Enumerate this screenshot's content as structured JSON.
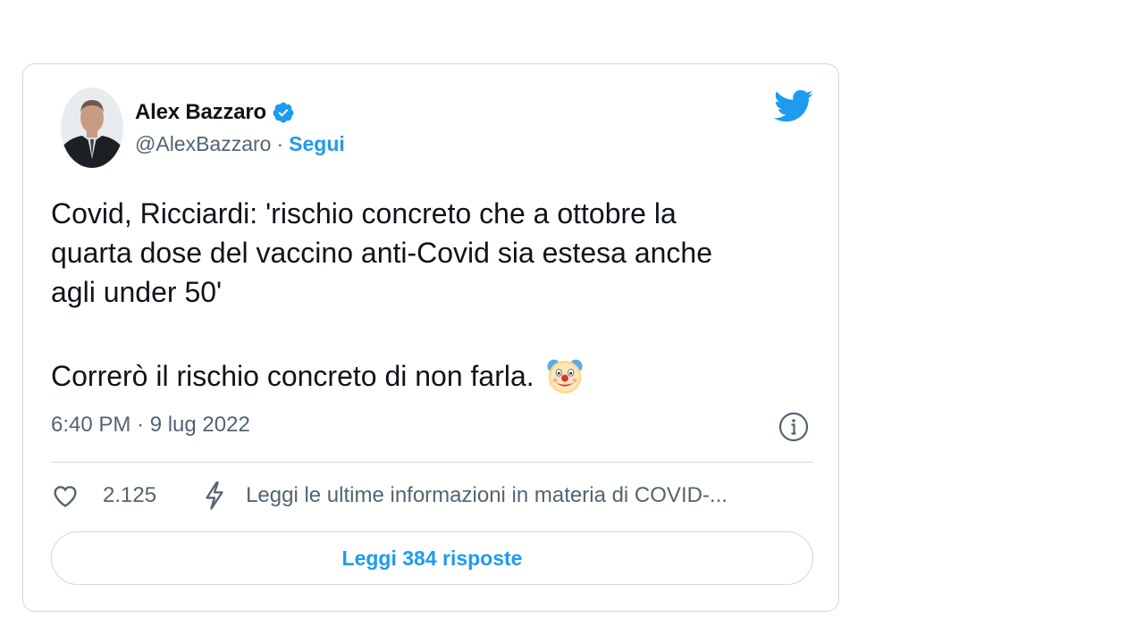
{
  "author": {
    "name": "Alex Bazzaro",
    "handle": "@AlexBazzaro",
    "separator": "·",
    "follow_label": "Segui",
    "verified": true
  },
  "tweet": {
    "text_paragraph_1": "Covid, Ricciardi: 'rischio concreto che a ottobre la\nquarta dose del vaccino anti-Covid sia estesa anche\nagli under 50'",
    "text_paragraph_2": "Correrò il rischio concreto di non farla.",
    "emoji": "clown-face",
    "timestamp": "6:40 PM · 9 lug 2022"
  },
  "actions": {
    "like_count": "2.125",
    "covid_info_label": "Leggi le ultime informazioni in materia di COVID-..."
  },
  "replies_button_label": "Leggi 384 risposte",
  "icons": {
    "verified": "verified-badge-icon",
    "twitter": "twitter-bird-icon",
    "info": "info-icon",
    "like": "heart-icon",
    "covid": "bolt-icon"
  },
  "colors": {
    "accent": "#1d9bf0",
    "text_primary": "#0f1419",
    "text_secondary": "#536471",
    "border": "#cfd9de"
  }
}
